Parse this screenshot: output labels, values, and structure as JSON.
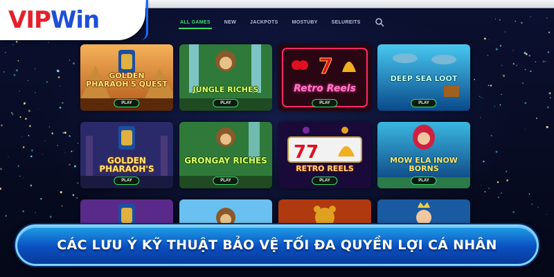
{
  "brand": {
    "logo_part1": "VIP",
    "logo_part2": "Win"
  },
  "nav": {
    "items": [
      {
        "label": "ALL GAMES",
        "active": true
      },
      {
        "label": "NEW",
        "active": false
      },
      {
        "label": "JACKPOTS",
        "active": false
      },
      {
        "label": "MOSTUBY",
        "active": false
      },
      {
        "label": "SELUREITS",
        "active": false
      }
    ],
    "search_icon": "search-icon"
  },
  "games": [
    {
      "title": "GOLDEN PHARAOH'S QUEST",
      "play": "PLAY",
      "theme": "pharaoh"
    },
    {
      "title": "JUNGLE RICHES",
      "play": "PLAY",
      "theme": "jungle"
    },
    {
      "title": "Retro Reels",
      "play": "PLAY",
      "theme": "retro-neon"
    },
    {
      "title": "DEEP SEA LOOT",
      "play": "PLAY",
      "theme": "sea"
    },
    {
      "title": "GOLDEN PHARAOH'S",
      "play": "PLAY",
      "theme": "pharaoh-night"
    },
    {
      "title": "GRONGAY RICHES",
      "play": "PLAY",
      "theme": "jungle"
    },
    {
      "title": "RETRO REELS",
      "play": "PLAY",
      "theme": "retro"
    },
    {
      "title": "MOW ELA INOW BORNS",
      "play": "PLAY",
      "theme": "mermaid"
    },
    {
      "title": "",
      "play": "",
      "theme": "pharaoh-purple"
    },
    {
      "title": "",
      "play": "",
      "theme": "monkey-sky"
    },
    {
      "title": "",
      "play": "",
      "theme": "bear-fire"
    },
    {
      "title": "",
      "play": "",
      "theme": "queen-sea"
    }
  ],
  "banner": {
    "text": "CÁC LƯU Ý KỸ THUẬT BẢO VỆ TỐI ĐA QUYỀN LỢI CÁ NHÂN"
  },
  "colors": {
    "accent_green": "#3de06a",
    "brand_red": "#e5202a",
    "brand_blue": "#1f4fd8",
    "banner_blue": "#0b4fc0"
  }
}
